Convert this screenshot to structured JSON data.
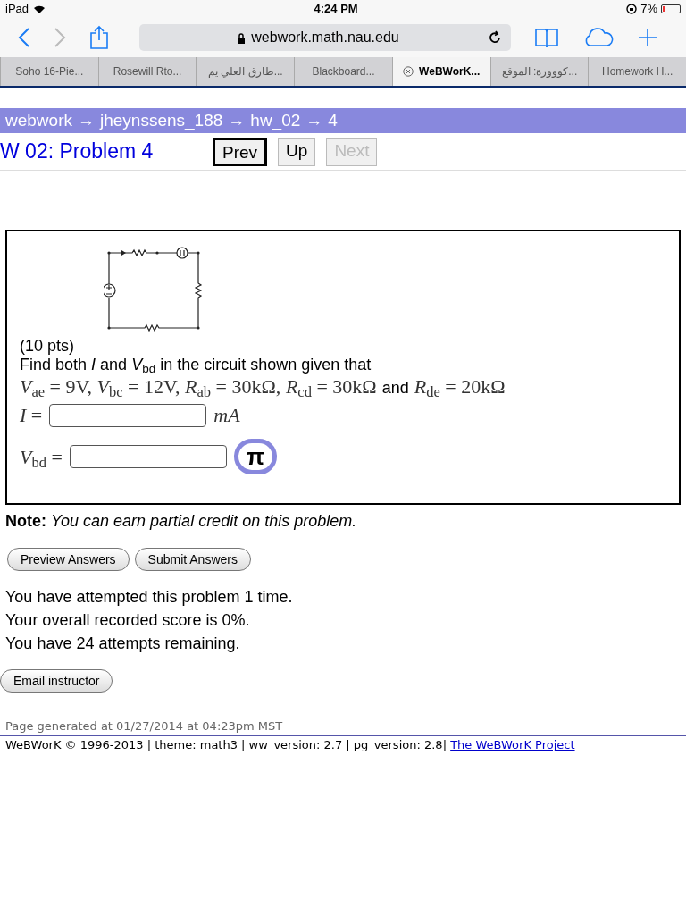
{
  "status_bar": {
    "device": "iPad",
    "time": "4:24 PM",
    "battery": "7%"
  },
  "toolbar": {
    "url": "webwork.math.nau.edu"
  },
  "tabs": [
    {
      "label": "Soho 16-Pie...",
      "selected": false
    },
    {
      "label": "Rosewill Rto...",
      "selected": false
    },
    {
      "label": "طارق العلي يم...",
      "selected": false
    },
    {
      "label": "Blackboard...",
      "selected": false
    },
    {
      "label": "WeBWorK...",
      "selected": true
    },
    {
      "label": "كووورة: الموقع...",
      "selected": false
    },
    {
      "label": "Homework H...",
      "selected": false
    }
  ],
  "breadcrumb": [
    "webwork",
    "jheynssens_188",
    "hw_02",
    "4"
  ],
  "breadcrumb_separator": "→",
  "page_title": "W 02: Problem 4",
  "nav_buttons": [
    {
      "label": "Prev",
      "disabled": false,
      "focused": true
    },
    {
      "label": "Up",
      "disabled": false,
      "focused": false
    },
    {
      "label": "Next",
      "disabled": true,
      "focused": false
    }
  ],
  "problem": {
    "points": "(10 pts)",
    "prompt": "Find both *I* and *V*$_{bd}$ in the circuit shown given that",
    "given_math": "*V*$_{ae}$ = 9V, *V*$_{bc}$ = 12V, *R*$_{ab}$ = 30kΩ, *R*$_{cd}$ = 30kΩ",
    "given_and": "and",
    "given_math_2": "*R*$_{de}$ = 20kΩ",
    "answers": [
      {
        "label": "*I* =",
        "unit": "mA",
        "has_equation_button": false
      },
      {
        "label": "*V*$_{bd}$ =",
        "has_equation_button": true,
        "equation_symbol": "π"
      }
    ]
  },
  "note_label": "Note:",
  "note_text": "You can earn partial credit on this problem.",
  "buttons": [
    "Preview Answers",
    "Submit Answers"
  ],
  "attempt_info": [
    "You have attempted this problem 1 time.",
    "Your overall recorded score is 0%.",
    "You have 24 attempts remaining."
  ],
  "email_button": "Email instructor",
  "footer": {
    "generated": "Page generated at 01/27/2014 at 04:23pm MST",
    "copyright": "WeBWorK © 1996-2013 | theme: math3 | ww_version: 2.7 | pg_version: 2.8|",
    "link": "The WeBWorK Project"
  }
}
